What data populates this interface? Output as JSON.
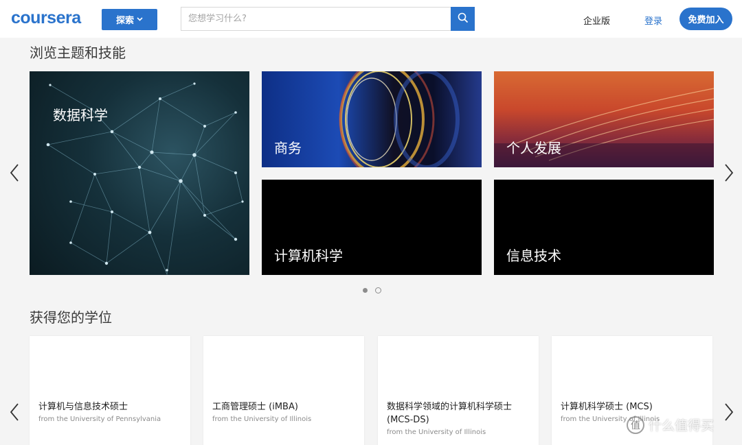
{
  "header": {
    "logo": "coursera",
    "explore_label": "探索",
    "search_placeholder": "您想学习什么?",
    "enterprise_label": "企业版",
    "login_label": "登录",
    "join_label": "免费加入"
  },
  "topics": {
    "title": "浏览主题和技能",
    "tiles": [
      {
        "label": "数据科学"
      },
      {
        "label": "商务"
      },
      {
        "label": "个人发展"
      },
      {
        "label": "计算机科学"
      },
      {
        "label": "信息技术"
      }
    ],
    "pagination": {
      "pages": 2,
      "active": 1
    }
  },
  "degrees": {
    "title": "获得您的学位",
    "cards": [
      {
        "title": "计算机与信息技术硕士",
        "subtitle": "from the University of Pennsylvania"
      },
      {
        "title": "工商管理硕士 (iMBA)",
        "subtitle": "from the University of Illinois"
      },
      {
        "title": "数据科学领域的计算机科学硕士 (MCS-DS)",
        "subtitle": "from the University of Illinois"
      },
      {
        "title": "计算机科学硕士 (MCS)",
        "subtitle": "from the University of Illinois"
      }
    ]
  },
  "watermark": {
    "badge": "值",
    "text": "什么值得买"
  },
  "colors": {
    "brand": "#2a73cc",
    "page_bg": "#f4f4f4"
  },
  "icons": {
    "search": "search-icon",
    "chevron_down": "chevron-down-icon",
    "arrow_left": "chevron-left-icon",
    "arrow_right": "chevron-right-icon"
  }
}
